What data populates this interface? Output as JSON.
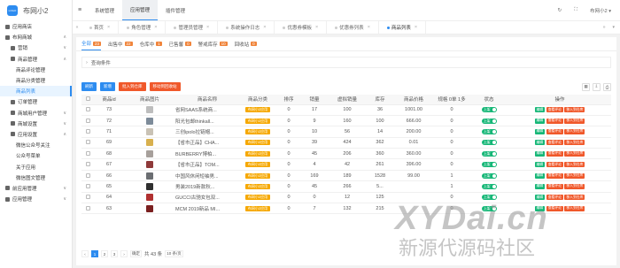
{
  "brand": {
    "logo_text": "布网小2",
    "logo_mark": "LOGO"
  },
  "sidebar": {
    "items": [
      {
        "label": "应用商店",
        "level": 0,
        "arrow": ""
      },
      {
        "label": "布网商城",
        "level": 0,
        "arrow": "∧"
      },
      {
        "label": "营销",
        "level": 1,
        "arrow": "∨"
      },
      {
        "label": "商品管理",
        "level": 1,
        "arrow": "∧"
      },
      {
        "label": "商品评论管理",
        "level": 2,
        "arrow": ""
      },
      {
        "label": "商品分类管理",
        "level": 2,
        "arrow": ""
      },
      {
        "label": "商品列表",
        "level": 2,
        "arrow": "",
        "active": true
      },
      {
        "label": "订单管理",
        "level": 1,
        "arrow": ""
      },
      {
        "label": "商城用户管理",
        "level": 1,
        "arrow": "∨"
      },
      {
        "label": "商城设置",
        "level": 1,
        "arrow": "∨"
      },
      {
        "label": "应用设置",
        "level": 1,
        "arrow": "∧"
      },
      {
        "label": "微信公众号关注",
        "level": 2,
        "arrow": ""
      },
      {
        "label": "公众号菜单",
        "level": 2,
        "arrow": ""
      },
      {
        "label": "关于应用",
        "level": 2,
        "arrow": ""
      },
      {
        "label": "微信图文管理",
        "level": 2,
        "arrow": ""
      },
      {
        "label": "前应用管理",
        "level": 0,
        "arrow": "∨"
      },
      {
        "label": "应用管理",
        "level": 0,
        "arrow": "∨"
      }
    ]
  },
  "header": {
    "menu_icon": "≡",
    "nav": [
      "系统管理",
      "应用管理",
      "插件管理"
    ],
    "active_nav": 1,
    "user": "布网小2"
  },
  "tags": [
    {
      "label": "首页",
      "active": false
    },
    {
      "label": "角色管理",
      "active": false
    },
    {
      "label": "管理员管理",
      "active": false
    },
    {
      "label": "系统操作日志",
      "active": false
    },
    {
      "label": "优惠券模板",
      "active": false
    },
    {
      "label": "优惠券列表",
      "active": false
    },
    {
      "label": "商品列表",
      "active": true
    }
  ],
  "status_tabs": [
    {
      "label": "全部",
      "count": "23",
      "active": true
    },
    {
      "label": "出售中",
      "count": "22",
      "active": false
    },
    {
      "label": "仓库中",
      "count": "1",
      "active": false
    },
    {
      "label": "已售馨",
      "count": "0",
      "active": false
    },
    {
      "label": "警戒库存",
      "count": "10",
      "active": false
    },
    {
      "label": "回收站",
      "count": "0",
      "active": false
    }
  ],
  "filter": {
    "label": "查询条件"
  },
  "toolbar": {
    "refresh": "刷新",
    "add": "新增",
    "to_warehouse": "批入到仓库",
    "to_recycle": "移动到回收站"
  },
  "table": {
    "headers": [
      "商品id",
      "商品图片",
      "商品名称",
      "商品分类",
      "排序",
      "销量",
      "虚拟销量",
      "库存",
      "商品价格",
      "规格 0单 1多",
      "状态",
      "操作"
    ],
    "rows": [
      {
        "id": "73",
        "img": "#bdbdbd",
        "name": "省网SAAS系统商...",
        "cat": "布网小2应用",
        "sort": "0",
        "sales": "17",
        "vsales": "100",
        "stock": "36",
        "price": "1001.00",
        "spec": "0"
      },
      {
        "id": "72",
        "img": "#7d8b99",
        "name": "阳光包邮thinkall...",
        "cat": "布网小2应用",
        "sort": "0",
        "sales": "9",
        "vsales": "160",
        "stock": "100",
        "price": "666.00",
        "spec": "0"
      },
      {
        "id": "71",
        "img": "#c9c2b5",
        "name": "三创ipolo拉链帽...",
        "cat": "布网小2应用",
        "sort": "0",
        "sales": "10",
        "vsales": "56",
        "stock": "14",
        "price": "200.00",
        "spec": "0"
      },
      {
        "id": "69",
        "img": "#d8b04e",
        "name": "【省市正品】CHA...",
        "cat": "布网小2应用",
        "sort": "0",
        "sales": "39",
        "vsales": "424",
        "stock": "362",
        "price": "0.01",
        "spec": "0"
      },
      {
        "id": "68",
        "img": "#a7a09b",
        "name": "BURBERRY博柏...",
        "cat": "布网小2应用",
        "sort": "0",
        "sales": "45",
        "vsales": "206",
        "stock": "360",
        "price": "360.00",
        "spec": "0"
      },
      {
        "id": "67",
        "img": "#8f3a3a",
        "name": "【省市正品】TOM...",
        "cat": "布网小2应用",
        "sort": "0",
        "sales": "4",
        "vsales": "42",
        "stock": "261",
        "price": "396.00",
        "spec": "0"
      },
      {
        "id": "66",
        "img": "#6b6e72",
        "name": "中国风休闲短袖男...",
        "cat": "布网小2应用",
        "sort": "0",
        "sales": "169",
        "vsales": "189",
        "stock": "1528",
        "price": "99.00",
        "spec": "1"
      },
      {
        "id": "65",
        "img": "#2f2f2f",
        "name": "男装2019新款秋...",
        "cat": "布网小2应用",
        "sort": "0",
        "sales": "45",
        "vsales": "266",
        "stock": "5...",
        "price": "",
        "spec": "1"
      },
      {
        "id": "64",
        "img": "#b03030",
        "name": "GUCCI古驰女包双...",
        "cat": "布网小2应用",
        "sort": "0",
        "sales": "0",
        "vsales": "12",
        "stock": "125",
        "price": "",
        "spec": "0"
      },
      {
        "id": "63",
        "img": "#7a1f1f",
        "name": "MCM 2019新品 MI...",
        "cat": "布网小2应用",
        "sort": "0",
        "sales": "7",
        "vsales": "132",
        "stock": "215",
        "price": "",
        "spec": "0"
      }
    ],
    "status_label": "上架",
    "op_edit": "编辑",
    "op_comment": "查看评论",
    "op_warehouse": "移入到仓库"
  },
  "pager": {
    "pages": [
      "1",
      "2",
      "3"
    ],
    "current": "1",
    "goto": "确定",
    "total": "共 43 条",
    "per_page": "10 条/页"
  },
  "watermark": {
    "line1": "XYDai.cn",
    "line2": "新源代源码社区"
  },
  "colors": {
    "accent": "#2d8cf0",
    "orange": "#f0582a",
    "green": "#16b777",
    "badge": "#f0843a"
  }
}
